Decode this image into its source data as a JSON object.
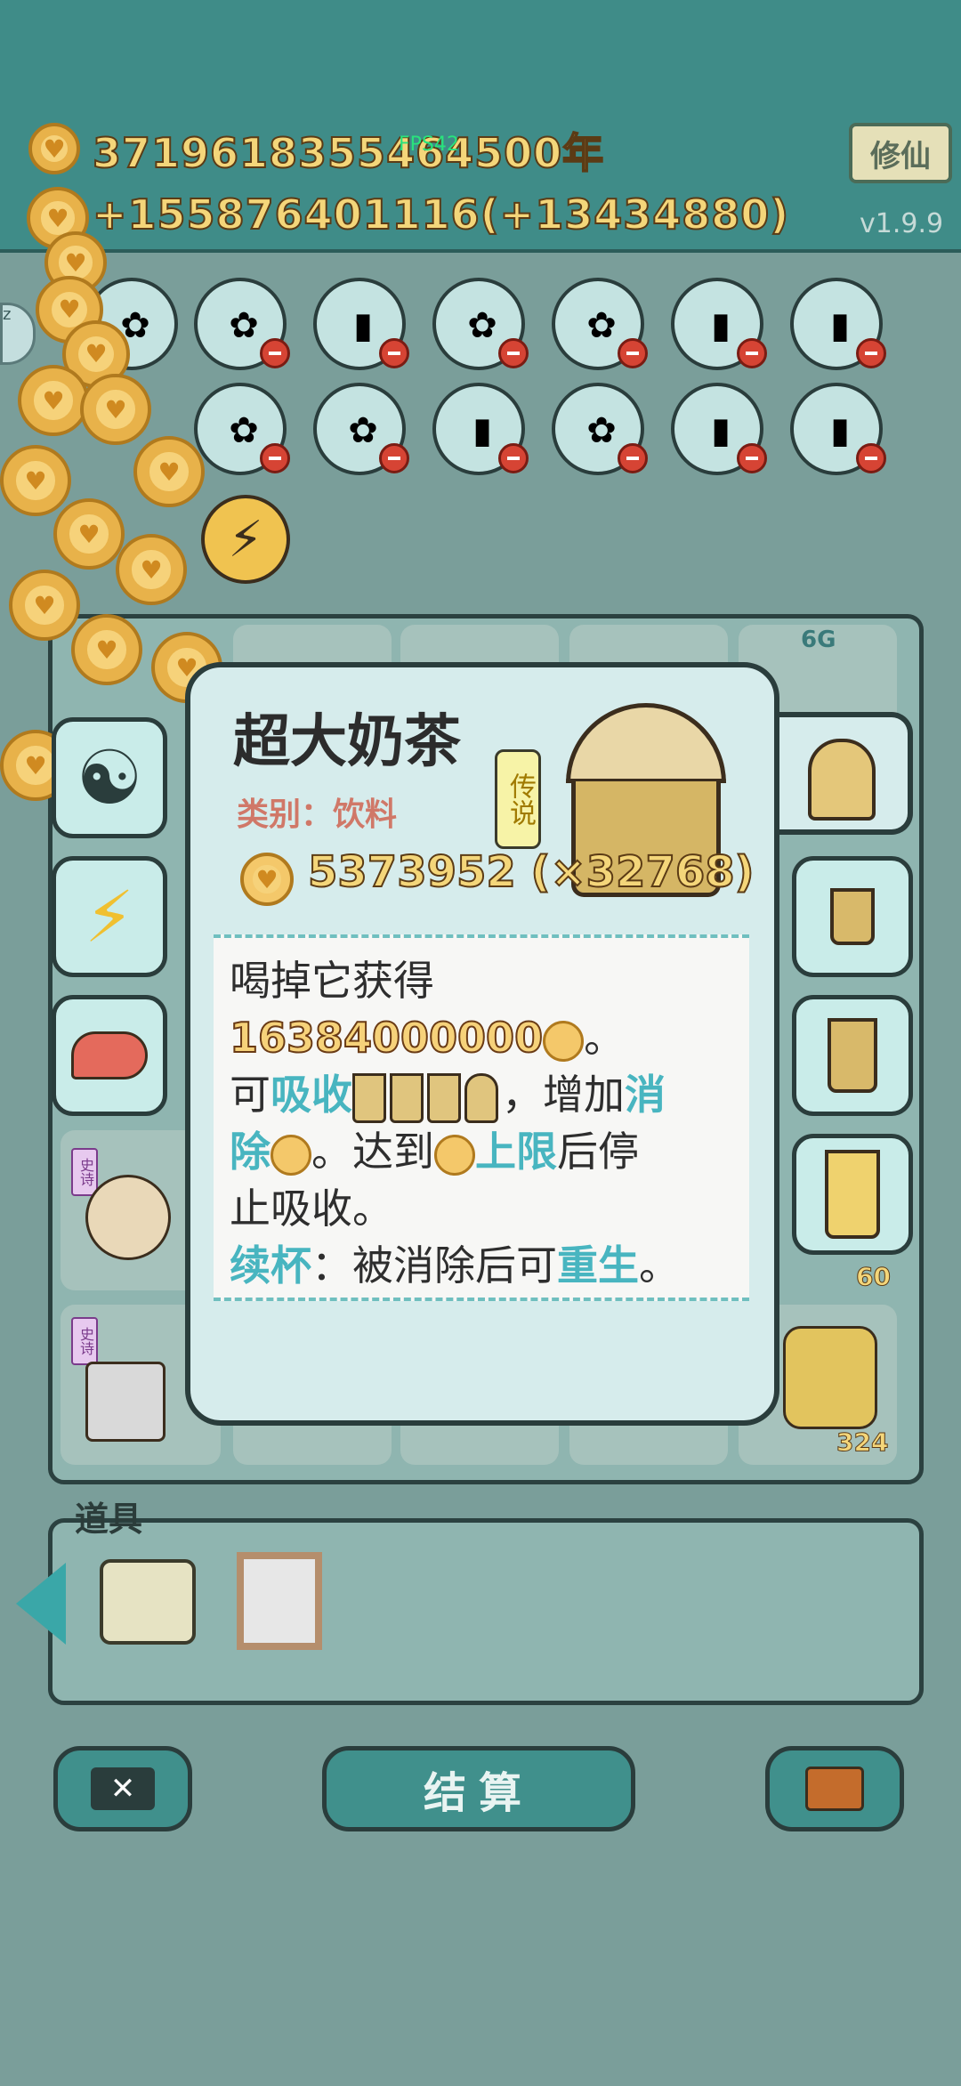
{
  "header": {
    "total_coins": "3719618355464",
    "years": "500年",
    "fps": "FPS42",
    "income": "+155876401116",
    "income_bonus": "(+13434880)",
    "cultivate_button": "修仙",
    "version": "v1.9.9"
  },
  "popup": {
    "title": "超大奶茶",
    "category_label": "类别：",
    "category_value": "饮料",
    "rarity": "传说",
    "price": "5373952 (×32768)",
    "desc_line1": "喝掉它获得",
    "desc_number": "16384000000",
    "desc_period": "。",
    "desc_can": "可",
    "desc_absorb": "吸收",
    "desc_add": "，增加",
    "desc_eliminate": "消除",
    "desc_reach": "。达到",
    "desc_limit": "上限",
    "desc_stop": "后停止吸收。",
    "refill_label": "续杯",
    "refill_text": "：被消除后可",
    "rebirth": "重生",
    "refill_end": "。"
  },
  "grid_tiles": {
    "tag_shi": "史诗",
    "tag_chuan": "传",
    "tag_6g": "6G",
    "count_60": "60",
    "count_324": "324"
  },
  "tools": {
    "label": "道具"
  },
  "bottom": {
    "settle_label": "结算"
  },
  "colors": {
    "teal_header": "#3f8c88",
    "coin_gold": "#e8b24a",
    "highlight": "#48b5c0"
  }
}
